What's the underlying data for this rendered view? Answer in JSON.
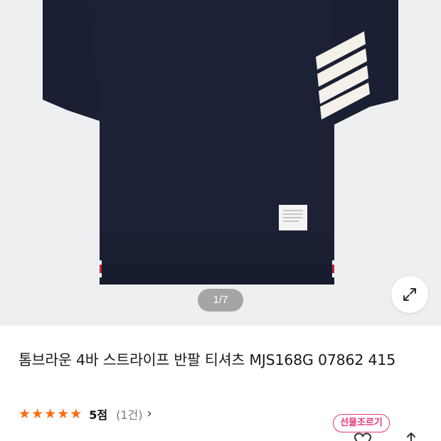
{
  "gallery": {
    "counter": "1/7",
    "expand_icon": "expand-arrows-icon"
  },
  "product": {
    "title": "톰브라운 4바 스트라이프 반팔 티셔츠 MJS168G 07862 415",
    "rating": {
      "stars": 5,
      "score_label": "5점",
      "review_count_label": "(1건)",
      "star_color": "#ff6a13"
    },
    "gift_label": "선물조르기",
    "gift_color": "#e8367a"
  },
  "colors": {
    "shirt_navy": "#1c2136",
    "image_bg": "#eeeff1"
  }
}
